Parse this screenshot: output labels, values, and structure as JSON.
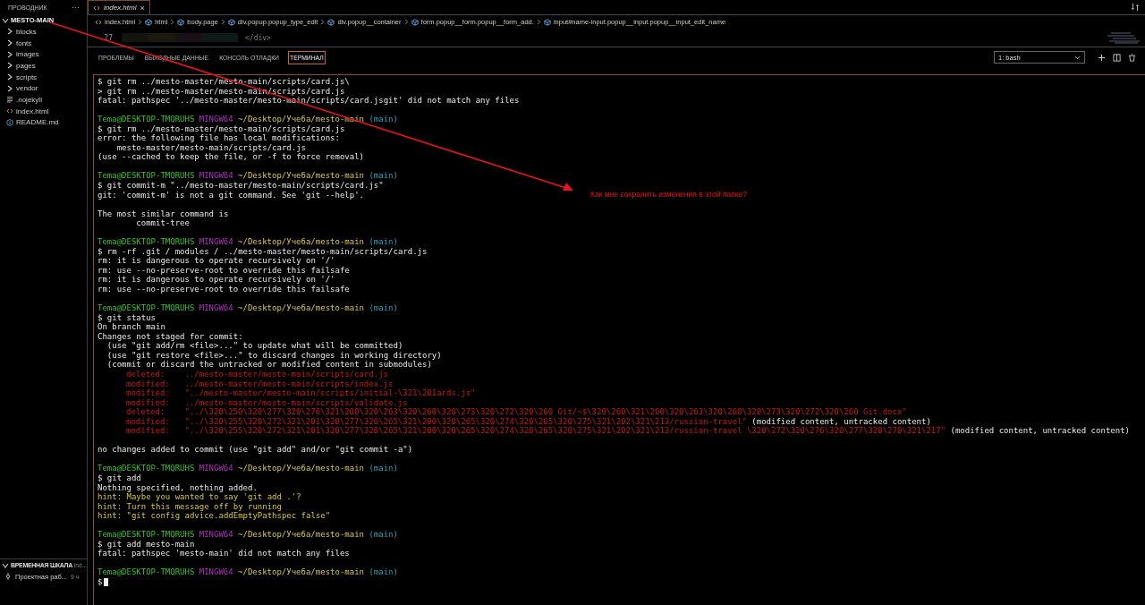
{
  "sidebar": {
    "title": "ПРОВОДНИК",
    "more": "···",
    "root": {
      "label": "MESTO-MAIN",
      "expanded": true,
      "children": [
        {
          "kind": "folder",
          "label": "blocks",
          "expanded": false
        },
        {
          "kind": "folder",
          "label": "fonts",
          "expanded": false
        },
        {
          "kind": "folder",
          "label": "images",
          "expanded": false
        },
        {
          "kind": "folder",
          "label": "pages",
          "expanded": false
        },
        {
          "kind": "folder",
          "label": "scripts",
          "expanded": false
        },
        {
          "kind": "folder",
          "label": "vendor",
          "expanded": false
        },
        {
          "kind": "plain",
          "label": ".nojekyll"
        },
        {
          "kind": "html",
          "label": "index.html"
        },
        {
          "kind": "info",
          "label": "README.md"
        }
      ]
    },
    "timeline": {
      "title": "ВРЕМЕННАЯ ШКАЛА",
      "file": "ind...",
      "expanded": true,
      "items": [
        {
          "label": "Проектная раб...",
          "time": "9 ч"
        }
      ]
    }
  },
  "tabs": [
    {
      "label": "index.html",
      "selected": true,
      "close": "×"
    }
  ],
  "breadcrumbs": [
    {
      "kind": "file",
      "label": "index.html"
    },
    {
      "kind": "element",
      "label": "html"
    },
    {
      "kind": "element",
      "label": "body.page"
    },
    {
      "kind": "element",
      "label": "div.popup.popup_type_edit"
    },
    {
      "kind": "element",
      "label": "div.popup__container"
    },
    {
      "kind": "element",
      "label": "form.popup__form.popup__form_add."
    },
    {
      "kind": "element",
      "label": "input#name-input.popup__input.popup__input_edit_name"
    }
  ],
  "editor": {
    "lines": [
      {
        "number": "27",
        "code": "</div>"
      }
    ]
  },
  "panel": {
    "tabs": [
      {
        "label": "ПРОБЛЕМЫ",
        "selected": false
      },
      {
        "label": "ВЫХОДНЫЕ ДАННЫЕ",
        "selected": false
      },
      {
        "label": "КОНСОЛЬ ОТЛАДКИ",
        "selected": false
      },
      {
        "label": "ТЕРМИНАЛ",
        "selected": true
      }
    ],
    "terminal_select": "1: bash"
  },
  "terminal": [
    {
      "kind": "text",
      "text": "$ git rm ../mesto-master/mesto-main/scripts/card.js\\"
    },
    {
      "kind": "text",
      "text": "> git rm ../mesto-master/mesto-main/scripts/card.js"
    },
    {
      "kind": "text",
      "text": "fatal: pathspec '../mesto-master/mesto-main/scripts/card.jsgit' did not match any files"
    },
    {
      "kind": "blank"
    },
    {
      "kind": "prompt",
      "user": "Tema@DESKTOP-TMQRUHS",
      "system": "MINGW64",
      "path": "~/Desktop/Учеба/mesto-main",
      "branch": "(main)"
    },
    {
      "kind": "text",
      "text": "$ git rm ../mesto-master/mesto-main/scripts/card.js"
    },
    {
      "kind": "text",
      "text": "error: the following file has local modifications:"
    },
    {
      "kind": "text",
      "text": "    mesto-master/mesto-main/scripts/card.js"
    },
    {
      "kind": "text",
      "text": "(use --cached to keep the file, or -f to force removal)"
    },
    {
      "kind": "blank"
    },
    {
      "kind": "prompt",
      "user": "Tema@DESKTOP-TMQRUHS",
      "system": "MINGW64",
      "path": "~/Desktop/Учеба/mesto-main",
      "branch": "(main)"
    },
    {
      "kind": "text",
      "text": "$ git commit-m \"../mesto-master/mesto-main/scripts/card.js\""
    },
    {
      "kind": "text",
      "text": "git: 'commit-m' is not a git command. See 'git --help'."
    },
    {
      "kind": "blank"
    },
    {
      "kind": "text",
      "text": "The most similar command is"
    },
    {
      "kind": "text",
      "text": "        commit-tree"
    },
    {
      "kind": "blank"
    },
    {
      "kind": "prompt",
      "user": "Tema@DESKTOP-TMQRUHS",
      "system": "MINGW64",
      "path": "~/Desktop/Учеба/mesto-main",
      "branch": "(main)"
    },
    {
      "kind": "text",
      "text": "$ rm -rf .git / modules / ../mesto-master/mesto-main/scripts/card.js"
    },
    {
      "kind": "text",
      "text": "rm: it is dangerous to operate recursively on '/'"
    },
    {
      "kind": "text",
      "text": "rm: use --no-preserve-root to override this failsafe"
    },
    {
      "kind": "text",
      "text": "rm: it is dangerous to operate recursively on '/'"
    },
    {
      "kind": "text",
      "text": "rm: use --no-preserve-root to override this failsafe"
    },
    {
      "kind": "blank"
    },
    {
      "kind": "prompt",
      "user": "Tema@DESKTOP-TMQRUHS",
      "system": "MINGW64",
      "path": "~/Desktop/Учеба/mesto-main",
      "branch": "(main)"
    },
    {
      "kind": "text",
      "text": "$ git status"
    },
    {
      "kind": "text",
      "text": "On branch main"
    },
    {
      "kind": "text",
      "text": "Changes not staged for commit:"
    },
    {
      "kind": "text",
      "text": "  (use \"git add/rm <file>...\" to update what will be committed)"
    },
    {
      "kind": "text",
      "text": "  (use \"git restore <file>...\" to discard changes in working directory)"
    },
    {
      "kind": "text",
      "text": "  (commit or discard the untracked or modified content in submodules)"
    },
    {
      "kind": "status",
      "label": "deleted:",
      "path": "../mesto-master/mesto-main/scripts/card.js"
    },
    {
      "kind": "status",
      "label": "modified:",
      "path": "../mesto-master/mesto-main/scripts/index.js"
    },
    {
      "kind": "status",
      "label": "modified:",
      "path": "\"../mesto-master/mesto-main/scripts/initial-\\321\\201ards.js\""
    },
    {
      "kind": "status",
      "label": "modified:",
      "path": "../mesto-master/mesto-main/scripts/validate.js"
    },
    {
      "kind": "status",
      "label": "deleted:",
      "path": "\"../\\320\\250\\320\\277\\320\\276\\321\\200\\320\\263\\320\\260\\320\\273\\320\\272\\320\\260 Git/~$\\320\\260\\321\\200\\320\\263\\320\\260\\320\\273\\320\\272\\320\\260 Git.docx\""
    },
    {
      "kind": "status",
      "label": "modified:",
      "path": "\"../\\320\\255\\320\\272\\321\\201\\320\\277\\320\\265\\321\\200\\320\\265\\320\\274\\320\\265\\320\\275\\321\\202\\321\\213/russian-travel\"",
      "note": "(modified content, untracked content)"
    },
    {
      "kind": "status",
      "label": "modified:",
      "path": "\"../\\320\\255\\320\\272\\321\\201\\320\\277\\320\\265\\321\\200\\320\\265\\320\\274\\320\\265\\320\\275\\321\\202\\321\\213/russian-travel \\320\\272\\320\\276\\320\\277\\320\\270\\321\\217\"",
      "note": "(modified content, untracked content)"
    },
    {
      "kind": "blank"
    },
    {
      "kind": "text",
      "text": "no changes added to commit (use \"git add\" and/or \"git commit -a\")"
    },
    {
      "kind": "blank"
    },
    {
      "kind": "prompt",
      "user": "Tema@DESKTOP-TMQRUHS",
      "system": "MINGW64",
      "path": "~/Desktop/Учеба/mesto-main",
      "branch": "(main)"
    },
    {
      "kind": "text",
      "text": "$ git add"
    },
    {
      "kind": "text",
      "text": "Nothing specified, nothing added."
    },
    {
      "kind": "hint",
      "text": "hint: Maybe you wanted to say 'git add .'?"
    },
    {
      "kind": "hint",
      "text": "hint: Turn this message off by running"
    },
    {
      "kind": "hint",
      "text": "hint: \"git config advice.addEmptyPathspec false\""
    },
    {
      "kind": "blank"
    },
    {
      "kind": "prompt",
      "user": "Tema@DESKTOP-TMQRUHS",
      "system": "MINGW64",
      "path": "~/Desktop/Учеба/mesto-main",
      "branch": "(main)"
    },
    {
      "kind": "text",
      "text": "$ git add mesto-main"
    },
    {
      "kind": "text",
      "text": "fatal: pathspec 'mesto-main' did not match any files"
    },
    {
      "kind": "blank"
    },
    {
      "kind": "prompt",
      "user": "Tema@DESKTOP-TMQRUHS",
      "system": "MINGW64",
      "path": "~/Desktop/Учеба/mesto-main",
      "branch": "(main)"
    },
    {
      "kind": "cursor",
      "text": "$"
    }
  ],
  "annotation": {
    "text": "Как мне сохранить изменения в этой папке?"
  }
}
